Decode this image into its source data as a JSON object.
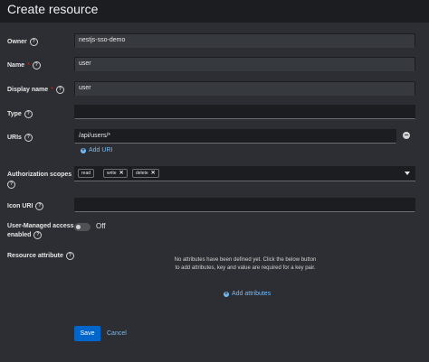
{
  "page": {
    "title": "Create resource"
  },
  "form": {
    "owner": {
      "label": "Owner",
      "value": "nestjs-sso-demo"
    },
    "name": {
      "label": "Name",
      "required_mark": "*",
      "value": "user"
    },
    "display_name": {
      "label": "Display name",
      "required_mark": "*",
      "value": "user"
    },
    "type": {
      "label": "Type",
      "value": ""
    },
    "uris": {
      "label": "URIs",
      "value": "/api/users/*",
      "add_label": "Add URI"
    },
    "authorization_scopes": {
      "label": "Authorization scopes",
      "chips": [
        "read",
        "write",
        "delete"
      ]
    },
    "icon_uri": {
      "label": "Icon URI",
      "value": ""
    },
    "user_managed_access": {
      "label_line1": "User-Managed access",
      "label_line2": "enabled",
      "state": "Off"
    },
    "resource_attribute": {
      "label": "Resource attribute",
      "empty_text": "No attributes have been defined yet. Click the below button to add attributes, key and value are required for a key pair.",
      "add_label": "Add attributes"
    }
  },
  "actions": {
    "save_label": "Save",
    "cancel_label": "Cancel"
  },
  "icons": {
    "help": "help-circle-icon",
    "remove": "minus-circle-icon",
    "add": "plus-circle-icon",
    "dropdown": "caret-down-icon",
    "chip_remove": "times-icon"
  },
  "colors": {
    "accent": "#0066cc",
    "link": "#73bcf7",
    "required": "#c9190b",
    "background": "#2c2e33"
  }
}
